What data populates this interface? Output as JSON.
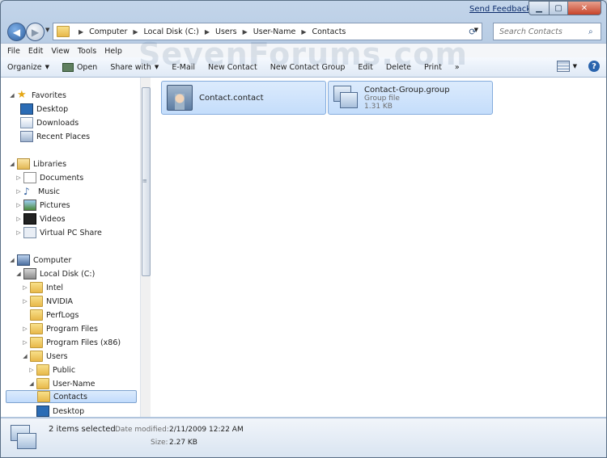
{
  "titlebar": {
    "feedback": "Send Feedback"
  },
  "breadcrumb": [
    "Computer",
    "Local Disk (C:)",
    "Users",
    "User-Name",
    "Contacts"
  ],
  "search": {
    "placeholder": "Search Contacts"
  },
  "menu": [
    "File",
    "Edit",
    "View",
    "Tools",
    "Help"
  ],
  "toolbar": {
    "organize": "Organize",
    "open": "Open",
    "share": "Share with",
    "email": "E-Mail",
    "new_contact": "New Contact",
    "new_group": "New Contact Group",
    "edit": "Edit",
    "delete": "Delete",
    "print": "Print",
    "more": "»"
  },
  "watermark": "SevenForums.com",
  "nav": {
    "favorites": "Favorites",
    "desktop": "Desktop",
    "downloads": "Downloads",
    "recent": "Recent Places",
    "libraries": "Libraries",
    "documents": "Documents",
    "music": "Music",
    "pictures": "Pictures",
    "videos": "Videos",
    "vpc": "Virtual PC Share",
    "computer": "Computer",
    "localdisk": "Local Disk (C:)",
    "intel": "Intel",
    "nvidia": "NVIDIA",
    "perflogs": "PerfLogs",
    "progfiles": "Program Files",
    "progfiles86": "Program Files (x86)",
    "users": "Users",
    "public": "Public",
    "username": "User-Name",
    "contacts": "Contacts",
    "udesktop": "Desktop"
  },
  "files": [
    {
      "name": "Contact.contact"
    },
    {
      "name": "Contact-Group.group",
      "type": "Group file",
      "size": "1.31 KB"
    }
  ],
  "status": {
    "selected": "2 items selected",
    "modified_label": "Date modified:",
    "modified_value": "2/11/2009 12:22 AM",
    "size_label": "Size:",
    "size_value": "2.27 KB"
  }
}
